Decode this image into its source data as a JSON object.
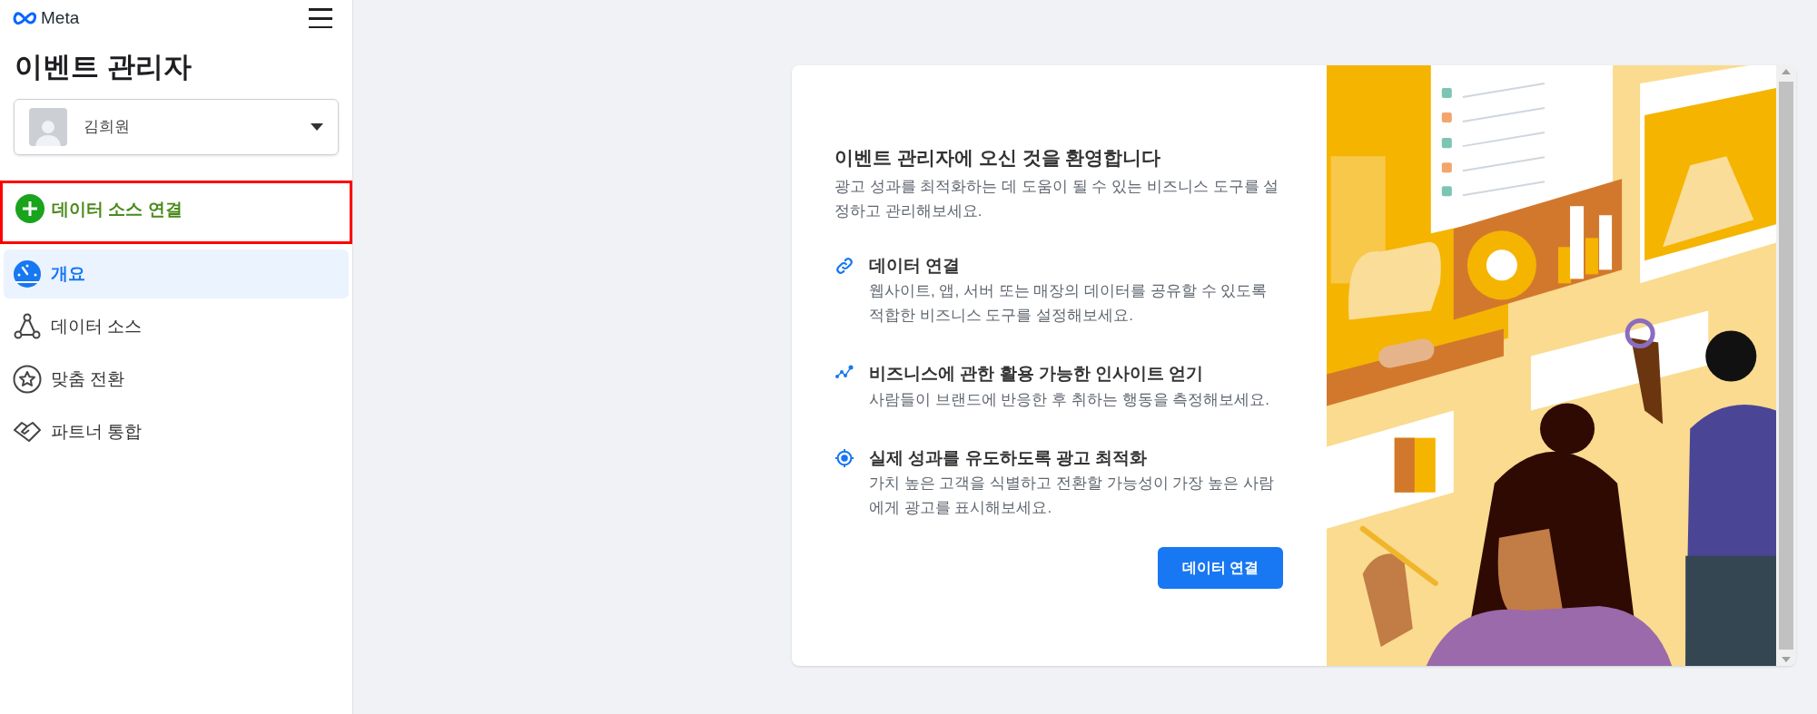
{
  "header": {
    "logo_text": "Meta"
  },
  "title": "이벤트 관리자",
  "account": {
    "name": "김희원"
  },
  "connect_action": {
    "label": "데이터 소스 연결",
    "highlighted": true
  },
  "nav": [
    {
      "label": "개요",
      "selected": true,
      "kind": "gauge"
    },
    {
      "label": "데이터 소스",
      "selected": false,
      "kind": "nodes"
    },
    {
      "label": "맞춤 전환",
      "selected": false,
      "kind": "star"
    },
    {
      "label": "파트너 통합",
      "selected": false,
      "kind": "handshake"
    }
  ],
  "welcome": {
    "title": "이벤트 관리자에 오신 것을 환영합니다",
    "description": "광고 성과를 최적화하는 데 도움이 될 수 있는 비즈니스 도구를 설정하고 관리해보세요.",
    "features": [
      {
        "kind": "link",
        "title": "데이터 연결",
        "description": "웹사이트, 앱, 서버 또는 매장의 데이터를 공유할 수 있도록 적합한 비즈니스 도구를 설정해보세요."
      },
      {
        "kind": "insight",
        "title": "비즈니스에 관한 활용 가능한 인사이트 얻기",
        "description": "사람들이 브랜드에 반응한 후 취하는 행동을 측정해보세요."
      },
      {
        "kind": "target",
        "title": "실제 성과를 유도하도록 광고 최적화",
        "description": "가치 높은 고객을 식별하고 전환할 가능성이 가장 높은 사람에게 광고를 표시해보세요."
      }
    ],
    "button": "데이터 연결"
  }
}
